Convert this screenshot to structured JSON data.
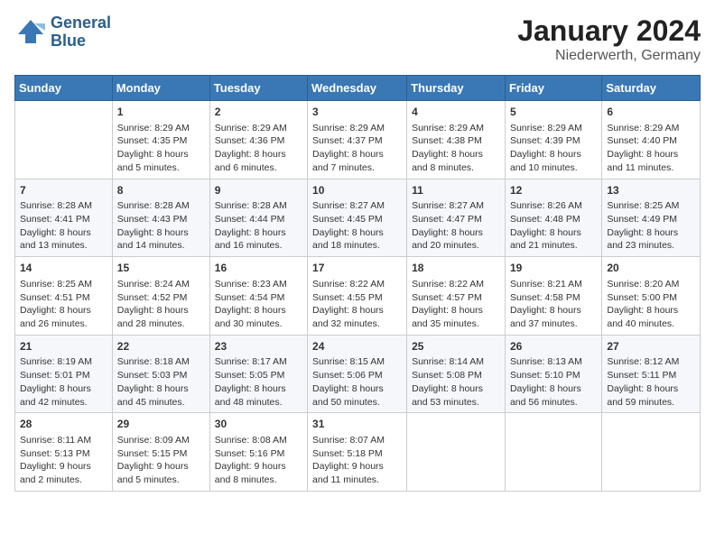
{
  "header": {
    "logo_line1": "General",
    "logo_line2": "Blue",
    "title": "January 2024",
    "subtitle": "Niederwerth, Germany"
  },
  "days_of_week": [
    "Sunday",
    "Monday",
    "Tuesday",
    "Wednesday",
    "Thursday",
    "Friday",
    "Saturday"
  ],
  "weeks": [
    [
      {
        "day": "",
        "info": ""
      },
      {
        "day": "1",
        "info": "Sunrise: 8:29 AM\nSunset: 4:35 PM\nDaylight: 8 hours\nand 5 minutes."
      },
      {
        "day": "2",
        "info": "Sunrise: 8:29 AM\nSunset: 4:36 PM\nDaylight: 8 hours\nand 6 minutes."
      },
      {
        "day": "3",
        "info": "Sunrise: 8:29 AM\nSunset: 4:37 PM\nDaylight: 8 hours\nand 7 minutes."
      },
      {
        "day": "4",
        "info": "Sunrise: 8:29 AM\nSunset: 4:38 PM\nDaylight: 8 hours\nand 8 minutes."
      },
      {
        "day": "5",
        "info": "Sunrise: 8:29 AM\nSunset: 4:39 PM\nDaylight: 8 hours\nand 10 minutes."
      },
      {
        "day": "6",
        "info": "Sunrise: 8:29 AM\nSunset: 4:40 PM\nDaylight: 8 hours\nand 11 minutes."
      }
    ],
    [
      {
        "day": "7",
        "info": "Sunrise: 8:28 AM\nSunset: 4:41 PM\nDaylight: 8 hours\nand 13 minutes."
      },
      {
        "day": "8",
        "info": "Sunrise: 8:28 AM\nSunset: 4:43 PM\nDaylight: 8 hours\nand 14 minutes."
      },
      {
        "day": "9",
        "info": "Sunrise: 8:28 AM\nSunset: 4:44 PM\nDaylight: 8 hours\nand 16 minutes."
      },
      {
        "day": "10",
        "info": "Sunrise: 8:27 AM\nSunset: 4:45 PM\nDaylight: 8 hours\nand 18 minutes."
      },
      {
        "day": "11",
        "info": "Sunrise: 8:27 AM\nSunset: 4:47 PM\nDaylight: 8 hours\nand 20 minutes."
      },
      {
        "day": "12",
        "info": "Sunrise: 8:26 AM\nSunset: 4:48 PM\nDaylight: 8 hours\nand 21 minutes."
      },
      {
        "day": "13",
        "info": "Sunrise: 8:25 AM\nSunset: 4:49 PM\nDaylight: 8 hours\nand 23 minutes."
      }
    ],
    [
      {
        "day": "14",
        "info": "Sunrise: 8:25 AM\nSunset: 4:51 PM\nDaylight: 8 hours\nand 26 minutes."
      },
      {
        "day": "15",
        "info": "Sunrise: 8:24 AM\nSunset: 4:52 PM\nDaylight: 8 hours\nand 28 minutes."
      },
      {
        "day": "16",
        "info": "Sunrise: 8:23 AM\nSunset: 4:54 PM\nDaylight: 8 hours\nand 30 minutes."
      },
      {
        "day": "17",
        "info": "Sunrise: 8:22 AM\nSunset: 4:55 PM\nDaylight: 8 hours\nand 32 minutes."
      },
      {
        "day": "18",
        "info": "Sunrise: 8:22 AM\nSunset: 4:57 PM\nDaylight: 8 hours\nand 35 minutes."
      },
      {
        "day": "19",
        "info": "Sunrise: 8:21 AM\nSunset: 4:58 PM\nDaylight: 8 hours\nand 37 minutes."
      },
      {
        "day": "20",
        "info": "Sunrise: 8:20 AM\nSunset: 5:00 PM\nDaylight: 8 hours\nand 40 minutes."
      }
    ],
    [
      {
        "day": "21",
        "info": "Sunrise: 8:19 AM\nSunset: 5:01 PM\nDaylight: 8 hours\nand 42 minutes."
      },
      {
        "day": "22",
        "info": "Sunrise: 8:18 AM\nSunset: 5:03 PM\nDaylight: 8 hours\nand 45 minutes."
      },
      {
        "day": "23",
        "info": "Sunrise: 8:17 AM\nSunset: 5:05 PM\nDaylight: 8 hours\nand 48 minutes."
      },
      {
        "day": "24",
        "info": "Sunrise: 8:15 AM\nSunset: 5:06 PM\nDaylight: 8 hours\nand 50 minutes."
      },
      {
        "day": "25",
        "info": "Sunrise: 8:14 AM\nSunset: 5:08 PM\nDaylight: 8 hours\nand 53 minutes."
      },
      {
        "day": "26",
        "info": "Sunrise: 8:13 AM\nSunset: 5:10 PM\nDaylight: 8 hours\nand 56 minutes."
      },
      {
        "day": "27",
        "info": "Sunrise: 8:12 AM\nSunset: 5:11 PM\nDaylight: 8 hours\nand 59 minutes."
      }
    ],
    [
      {
        "day": "28",
        "info": "Sunrise: 8:11 AM\nSunset: 5:13 PM\nDaylight: 9 hours\nand 2 minutes."
      },
      {
        "day": "29",
        "info": "Sunrise: 8:09 AM\nSunset: 5:15 PM\nDaylight: 9 hours\nand 5 minutes."
      },
      {
        "day": "30",
        "info": "Sunrise: 8:08 AM\nSunset: 5:16 PM\nDaylight: 9 hours\nand 8 minutes."
      },
      {
        "day": "31",
        "info": "Sunrise: 8:07 AM\nSunset: 5:18 PM\nDaylight: 9 hours\nand 11 minutes."
      },
      {
        "day": "",
        "info": ""
      },
      {
        "day": "",
        "info": ""
      },
      {
        "day": "",
        "info": ""
      }
    ]
  ]
}
